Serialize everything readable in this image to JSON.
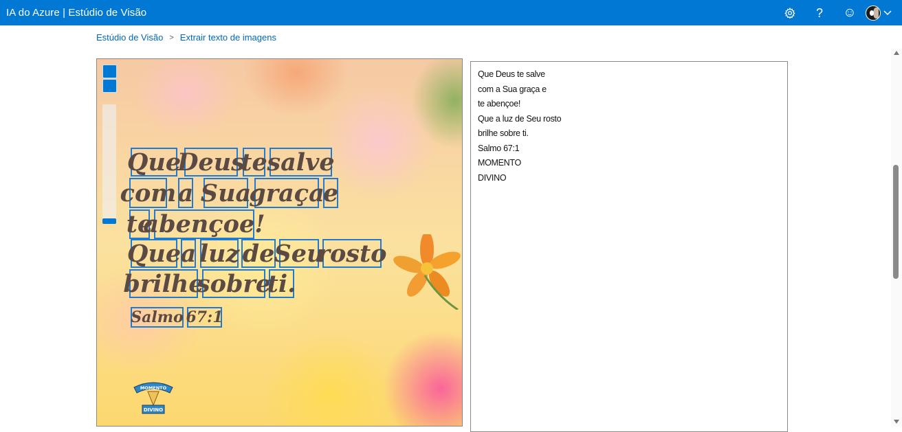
{
  "app": {
    "title": "IA do Azure | Estúdio de Visão"
  },
  "header_icons": [
    "gear-icon",
    "help-icon",
    "smiley-icon",
    "chevron-down-icon"
  ],
  "header": {
    "help_glyph": "?",
    "feedback_glyph": "☺"
  },
  "breadcrumb": {
    "home": "Estúdio de Visão",
    "separator": ">",
    "current": "Extrair texto de imagens"
  },
  "image": {
    "lines": [
      [
        "Que",
        "Deus",
        "te",
        "salve"
      ],
      [
        "com",
        "a",
        "Sua",
        "graça",
        "e"
      ],
      [
        "te",
        "abençoe!"
      ],
      [
        "Que",
        "a",
        "luz",
        "de",
        "Seu",
        "rosto"
      ],
      [
        "brilhe",
        "sobre",
        "ti."
      ],
      [
        "Salmo",
        "67:1"
      ]
    ],
    "logo_text_top": "MOMENTO",
    "logo_text_bottom": "DIVINO",
    "colors": {
      "bbox": "#1e7bd1",
      "text": "#5b4a44"
    }
  },
  "extracted_text": {
    "lines": [
      "Que Deus te salve",
      "com a Sua graça e",
      "te abençoe!",
      "Que a luz de Seu rosto",
      "brilhe sobre ti.",
      "Salmo 67:1",
      "MOMENTO",
      "DIVINO"
    ]
  },
  "theme": {
    "accent": "#0078d4",
    "link": "#0067b8"
  }
}
